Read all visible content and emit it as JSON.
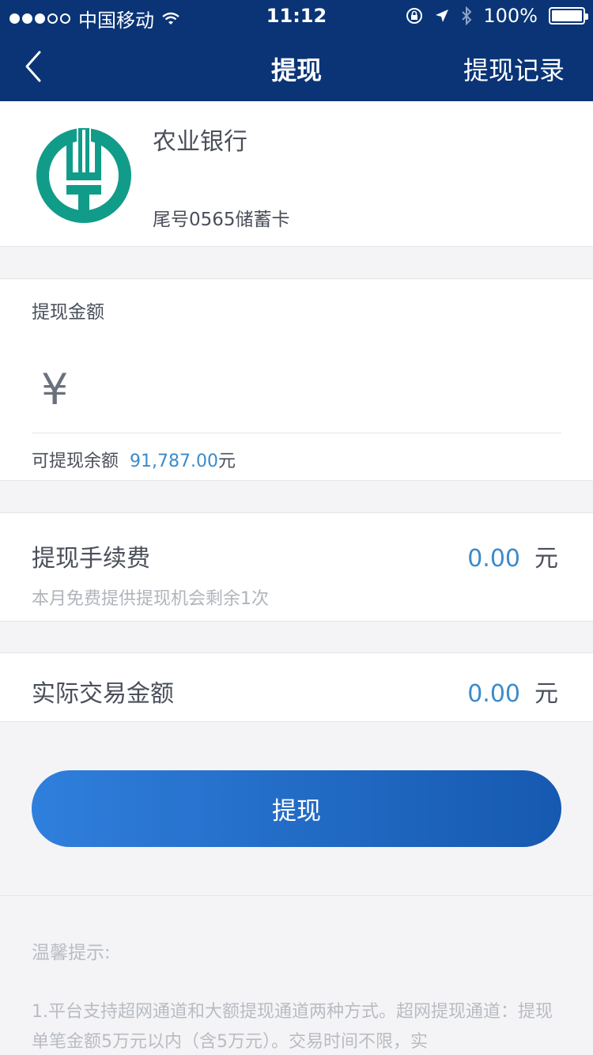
{
  "status_bar": {
    "carrier": "中国移动",
    "time": "11:12",
    "battery": "100%"
  },
  "nav": {
    "title": "提现",
    "right_action": "提现记录"
  },
  "bank": {
    "name": "农业银行",
    "tail": "尾号0565储蓄卡",
    "logo": "abc-bank-logo",
    "logo_color": "#119c8a"
  },
  "amount": {
    "label": "提现金额",
    "currency_symbol": "¥",
    "input_value": "",
    "available_label": "可提现余额",
    "available_value": "91,787.00",
    "available_unit": "元"
  },
  "fee": {
    "label": "提现手续费",
    "value": "0.00",
    "unit": "元",
    "note": "本月免费提供提现机会剩余1次"
  },
  "actual": {
    "label": "实际交易金额",
    "value": "0.00",
    "unit": "元"
  },
  "submit": {
    "label": "提现"
  },
  "tips": {
    "title": "温馨提示:",
    "text": "1.平台支持超网通道和大额提现通道两种方式。超网提现通道：提现单笔金额5万元以内（含5万元）。交易时间不限，实"
  },
  "colors": {
    "nav_bg": "#0a3476",
    "accent": "#3b8bcc",
    "button_start": "#2f7fdc",
    "button_end": "#1659b0"
  }
}
